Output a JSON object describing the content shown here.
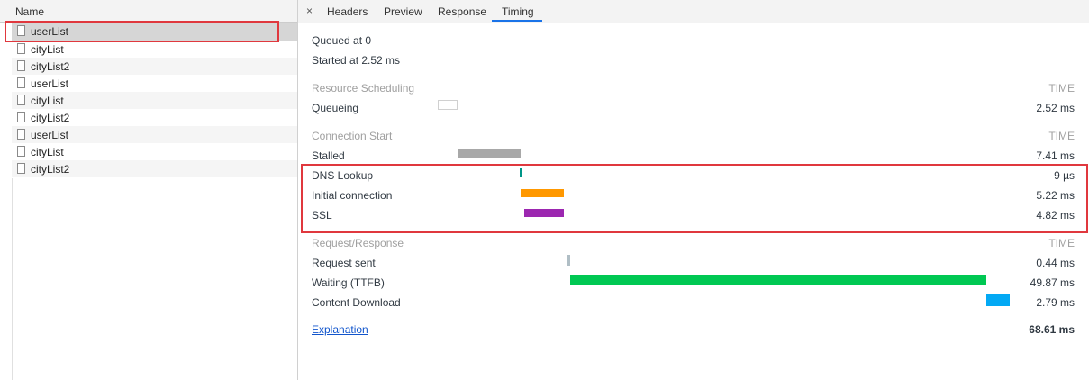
{
  "sidebar": {
    "header": "Name",
    "items": [
      {
        "label": "userList",
        "selected": true
      },
      {
        "label": "cityList"
      },
      {
        "label": "cityList2"
      },
      {
        "label": "userList"
      },
      {
        "label": "cityList"
      },
      {
        "label": "cityList2"
      },
      {
        "label": "userList"
      },
      {
        "label": "cityList"
      },
      {
        "label": "cityList2"
      }
    ]
  },
  "tabs": {
    "close": "×",
    "items": [
      "Headers",
      "Preview",
      "Response",
      "Timing"
    ],
    "active": "Timing"
  },
  "timing": {
    "queued_at": "Queued at 0",
    "started_at": "Started at 2.52 ms",
    "time_header": "TIME",
    "sections": [
      {
        "title": "Resource Scheduling",
        "rows": [
          {
            "label": "Queueing",
            "value": "2.52 ms"
          }
        ]
      },
      {
        "title": "Connection Start",
        "rows": [
          {
            "label": "Stalled",
            "value": "7.41 ms"
          },
          {
            "label": "DNS Lookup",
            "value": "9 µs"
          },
          {
            "label": "Initial connection",
            "value": "5.22 ms"
          },
          {
            "label": "SSL",
            "value": "4.82 ms"
          }
        ]
      },
      {
        "title": "Request/Response",
        "rows": [
          {
            "label": "Request sent",
            "value": "0.44 ms"
          },
          {
            "label": "Waiting (TTFB)",
            "value": "49.87 ms"
          },
          {
            "label": "Content Download",
            "value": "2.79 ms"
          }
        ]
      }
    ],
    "explanation": "Explanation",
    "total": "68.61 ms",
    "colors": {
      "queueing": "#ffffff",
      "stalled": "#a8a8a8",
      "dns": "#009688",
      "initial": "#ff9800",
      "ssl": "#9c27b0",
      "sent": "#b0bec5",
      "ttfb": "#00c853",
      "download": "#03a9f4",
      "highlight": "#e0383e"
    }
  }
}
